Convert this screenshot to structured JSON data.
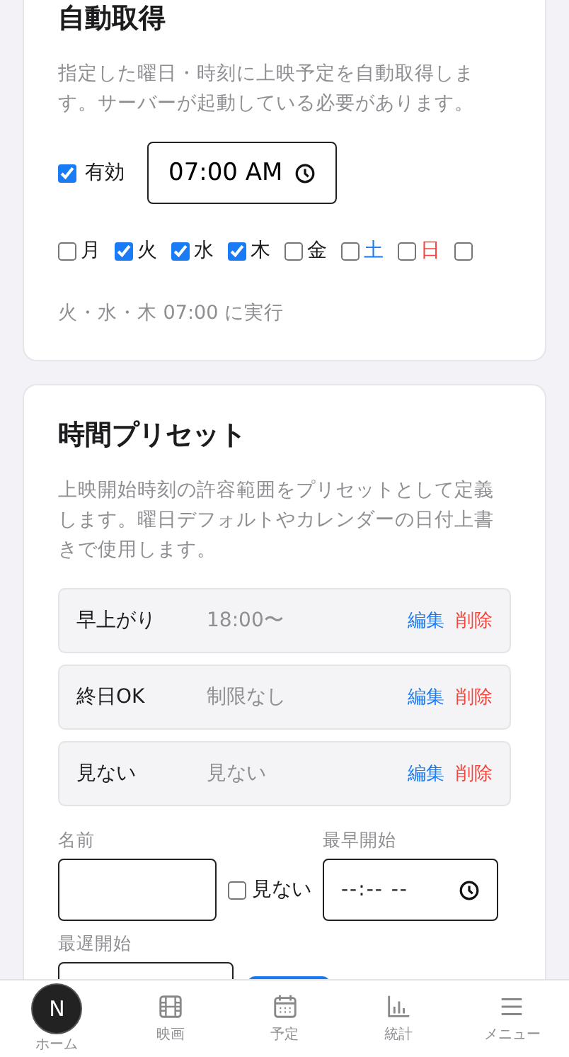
{
  "auto_fetch": {
    "title": "自動取得",
    "description": "指定した曜日・時刻に上映予定を自動取得します。サーバーが起動している必要があります。",
    "enabled": {
      "label": "有効",
      "checked": true
    },
    "time": {
      "value": "07:00 AM"
    },
    "days": [
      {
        "label": "月",
        "checked": false,
        "color": "#1c1c1e"
      },
      {
        "label": "火",
        "checked": true,
        "color": "#1c1c1e"
      },
      {
        "label": "水",
        "checked": true,
        "color": "#1c1c1e"
      },
      {
        "label": "木",
        "checked": true,
        "color": "#1c1c1e"
      },
      {
        "label": "金",
        "checked": false,
        "color": "#1c1c1e"
      },
      {
        "label": "土",
        "checked": false,
        "color": "#1a7cf5"
      },
      {
        "label": "日",
        "checked": false,
        "color": "#f5453d"
      },
      {
        "checked": false
      }
    ],
    "summary": "火・水・木 07:00 に実行"
  },
  "presets": {
    "title": "時間プリセット",
    "description": "上映開始時刻の許容範囲をプリセットとして定義します。曜日デフォルトやカレンダーの日付上書きで使用します。",
    "items": [
      {
        "name": "早上がり",
        "range": "18:00〜",
        "edit": "編集",
        "delete": "削除"
      },
      {
        "name": "終日OK",
        "range": "制限なし",
        "edit": "編集",
        "delete": "削除"
      },
      {
        "name": "見ない",
        "range": "見ない",
        "edit": "編集",
        "delete": "削除"
      }
    ],
    "form": {
      "name_label": "名前",
      "skip": {
        "label": "見ない",
        "checked": false
      },
      "earliest_label": "最早開始",
      "earliest_placeholder": "--:-- --",
      "latest_label": "最遅開始"
    }
  },
  "avatar": "N",
  "nav": [
    {
      "label": "ホーム",
      "kind": "avatar"
    },
    {
      "label": "映画",
      "kind": "film"
    },
    {
      "label": "予定",
      "kind": "calendar"
    },
    {
      "label": "統計",
      "kind": "chart"
    },
    {
      "label": "メニュー",
      "kind": "menu"
    }
  ]
}
